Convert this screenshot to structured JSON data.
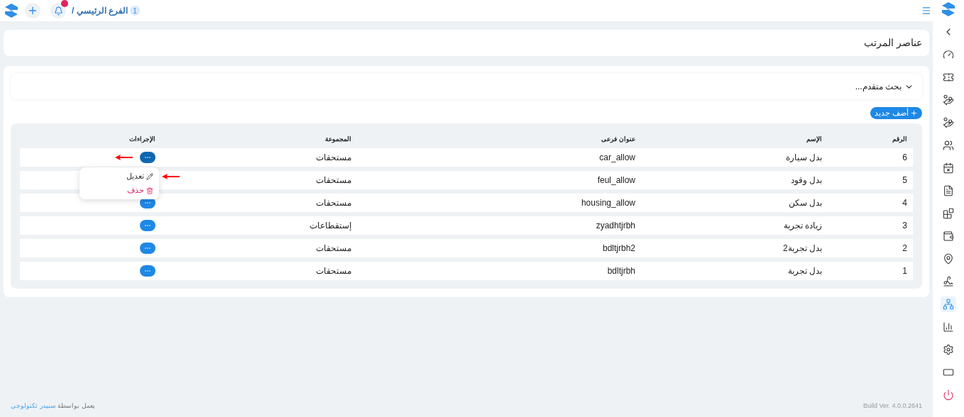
{
  "top_bar": {
    "branch_number": "1",
    "branch": "الفرع الرئيسي /"
  },
  "sidebar": {
    "items": [
      {
        "kind": "back",
        "selected": false
      },
      {
        "kind": "gauge",
        "selected": false
      },
      {
        "kind": "ticket",
        "selected": false
      },
      {
        "kind": "coins",
        "selected": false
      },
      {
        "kind": "coins",
        "selected": false
      },
      {
        "kind": "users",
        "selected": false
      },
      {
        "kind": "calendar",
        "selected": false
      },
      {
        "kind": "document",
        "selected": false
      },
      {
        "kind": "blocks",
        "selected": false
      },
      {
        "kind": "wallet",
        "selected": false
      },
      {
        "kind": "pin",
        "selected": false
      },
      {
        "kind": "signature",
        "selected": false
      },
      {
        "kind": "network",
        "selected": true
      },
      {
        "kind": "chart",
        "selected": false
      },
      {
        "kind": "settings",
        "selected": false
      },
      {
        "kind": "screen",
        "selected": false
      },
      {
        "kind": "power",
        "selected": false
      }
    ]
  },
  "page_title": "عناصر المرتب",
  "advanced_search": {
    "label": "بحث متقدم...",
    "expanded": false
  },
  "add_button": "أضف جديد",
  "table": {
    "columns": [
      "الرقم",
      "الإسم",
      "عنوان فرعى",
      "المجموعة",
      "الإجراءات"
    ],
    "rows": [
      {
        "number": "6",
        "name": "بدل سيارة",
        "subtitle": "car_allow",
        "group": "مستحقات",
        "menu_open": true
      },
      {
        "number": "5",
        "name": "بدل وقود",
        "subtitle": "feul_allow",
        "group": "مستحقات",
        "menu_open": false
      },
      {
        "number": "4",
        "name": "بدل سكن",
        "subtitle": "housing_allow",
        "group": "مستحقات",
        "menu_open": false
      },
      {
        "number": "3",
        "name": "زيادة تجربة",
        "subtitle": "zyadhtjrbh",
        "group": "إستقطاعات",
        "menu_open": false
      },
      {
        "number": "2",
        "name": "بدل تجربة2",
        "subtitle": "bdltjrbh2",
        "group": "مستحقات",
        "menu_open": false
      },
      {
        "number": "1",
        "name": "بدل تجربة",
        "subtitle": "bdltjrbh",
        "group": "مستحقات",
        "menu_open": false
      }
    ]
  },
  "actions_menu": [
    {
      "kind": "edit",
      "label": "تعديل"
    },
    {
      "kind": "delete",
      "label": "حذف"
    }
  ],
  "footer": {
    "build": "Build Ver. 4.0.0.2641",
    "powered_by": "يعمل بواسطة",
    "company": "سبيدر تكنولوجى"
  }
}
